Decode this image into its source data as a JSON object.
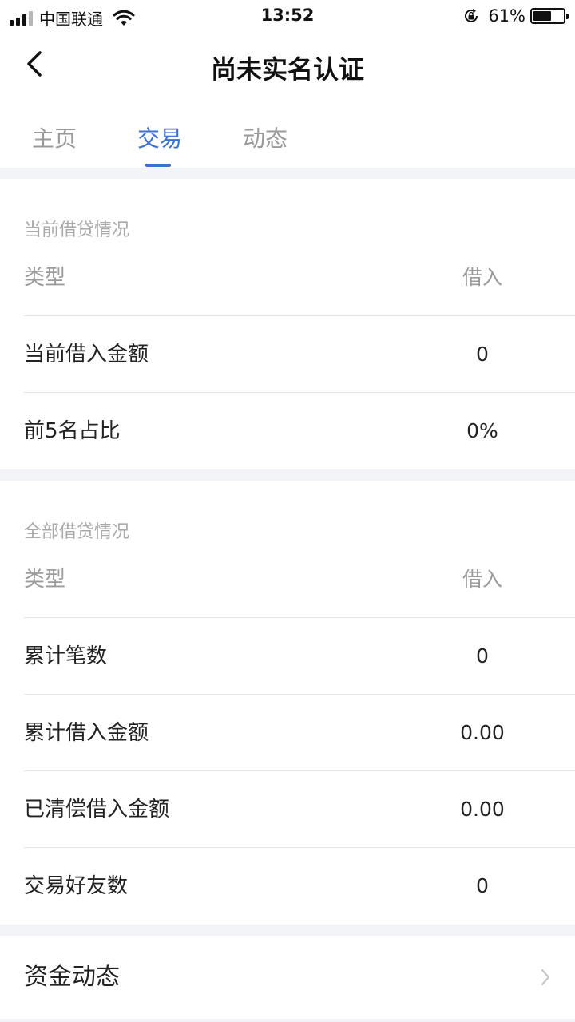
{
  "status_bar": {
    "carrier": "中国联通",
    "time": "13:52",
    "battery": "61%",
    "battery_level": 0.61
  },
  "nav": {
    "title": "尚未实名认证"
  },
  "tabs": [
    {
      "label": "主页",
      "active": false
    },
    {
      "label": "交易",
      "active": true
    },
    {
      "label": "动态",
      "active": false
    }
  ],
  "current_loans": {
    "title": "当前借贷情况",
    "header": {
      "type": "类型",
      "borrow": "借入"
    },
    "rows": [
      {
        "label": "当前借入金额",
        "value": "0"
      },
      {
        "label": "前5名占比",
        "value": "0%"
      }
    ]
  },
  "all_loans": {
    "title": "全部借贷情况",
    "header": {
      "type": "类型",
      "borrow": "借入"
    },
    "rows": [
      {
        "label": "累计笔数",
        "value": "0"
      },
      {
        "label": "累计借入金额",
        "value": "0.00"
      },
      {
        "label": "已清偿借入金额",
        "value": "0.00"
      },
      {
        "label": "交易好友数",
        "value": "0"
      }
    ]
  },
  "funds": {
    "label": "资金动态"
  },
  "colors": {
    "accent": "#3a6fd8",
    "section_gap": "#f3f4f8",
    "muted_text": "#9a9a9a"
  }
}
